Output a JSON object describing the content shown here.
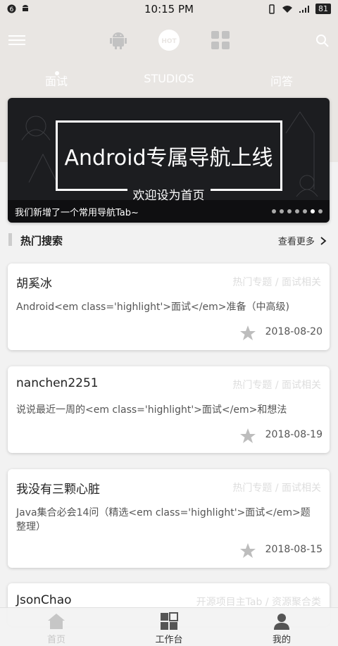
{
  "status_bar": {
    "time": "10:15 PM",
    "battery": "81"
  },
  "tabs": [
    {
      "label": "面试"
    },
    {
      "label": "STUDIOS"
    },
    {
      "label": "问答"
    }
  ],
  "banner": {
    "title": "Android专属导航上线",
    "subtitle": "欢迎设为首页",
    "caption": "我们新增了一个常用导航Tab~",
    "dot_count": 7,
    "active_dot": 5
  },
  "section": {
    "title": "热门搜索",
    "more": "查看更多"
  },
  "articles": [
    {
      "author": "胡奚冰",
      "category": "热门专题 / 面试相关",
      "title": "Android<em class='highlight'>面试</em>准备（中高级)",
      "date": "2018-08-20"
    },
    {
      "author": "nanchen2251",
      "category": "热门专题 / 面试相关",
      "title": "说说最近一周的<em class='highlight'>面试</em>和想法",
      "date": "2018-08-19"
    },
    {
      "author": "我没有三颗心脏",
      "category": "热门专题 / 面试相关",
      "title": "Java集合必会14问（精选<em class='highlight'>面试</em>题整理）",
      "date": "2018-08-15"
    },
    {
      "author": "JsonChao",
      "category": "开源项目主Tab / 资源聚合类",
      "title": "",
      "date": ""
    }
  ],
  "bottom_nav": [
    {
      "label": "首页"
    },
    {
      "label": "工作台"
    },
    {
      "label": "我的"
    }
  ],
  "colors": {
    "header_bg": "#e9e6e3",
    "page_bg": "#f2f2f2",
    "star": "#bdbdbd"
  }
}
